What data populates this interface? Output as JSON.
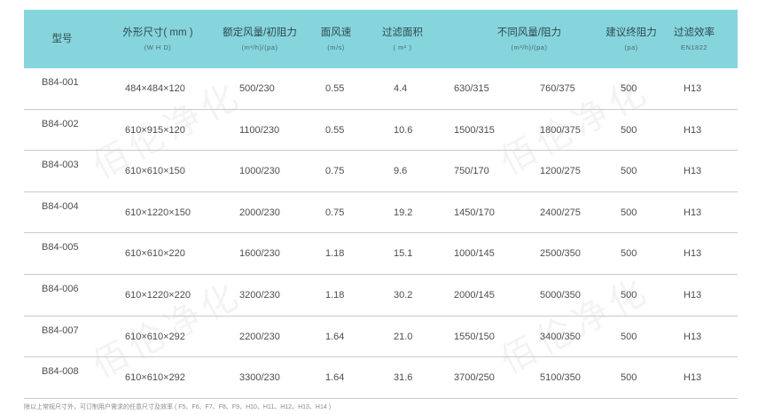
{
  "headers": {
    "model": {
      "main": "型号",
      "sub": ""
    },
    "size": {
      "main": "外形尺寸( mm )",
      "sub": "(W H D)"
    },
    "rated": {
      "main": "额定风量/初阻力",
      "sub": "(m³/h)/(pa)"
    },
    "velocity": {
      "main": "面风速",
      "sub": "(m/s)"
    },
    "area": {
      "main": "过滤面积",
      "sub": "( m² )"
    },
    "diff": {
      "main": "不同风量/阻力",
      "sub": "(m³/h)/(pa)"
    },
    "final": {
      "main": "建议终阻力",
      "sub": "(pa)"
    },
    "eff": {
      "main": "过滤效率",
      "sub": "EN1822"
    }
  },
  "rows": [
    {
      "model": "B84-001",
      "size": "484×484×120",
      "rated": "500/230",
      "velocity": "0.55",
      "area": "4.4",
      "diff1": "630/315",
      "diff2": "760/375",
      "final": "500",
      "eff": "H13"
    },
    {
      "model": "B84-002",
      "size": "610×915×120",
      "rated": "1100/230",
      "velocity": "0.55",
      "area": "10.6",
      "diff1": "1500/315",
      "diff2": "1800/375",
      "final": "500",
      "eff": "H13"
    },
    {
      "model": "B84-003",
      "size": "610×610×150",
      "rated": "1000/230",
      "velocity": "0.75",
      "area": "9.6",
      "diff1": "750/170",
      "diff2": "1200/275",
      "final": "500",
      "eff": "H13"
    },
    {
      "model": "B84-004",
      "size": "610×1220×150",
      "rated": "2000/230",
      "velocity": "0.75",
      "area": "19.2",
      "diff1": "1450/170",
      "diff2": "2400/275",
      "final": "500",
      "eff": "H13"
    },
    {
      "model": "B84-005",
      "size": "610×610×220",
      "rated": "1600/230",
      "velocity": "1.18",
      "area": "15.1",
      "diff1": "1000/145",
      "diff2": "2500/350",
      "final": "500",
      "eff": "H13"
    },
    {
      "model": "B84-006",
      "size": "610×1220×220",
      "rated": "3200/230",
      "velocity": "1.18",
      "area": "30.2",
      "diff1": "2000/145",
      "diff2": "5000/350",
      "final": "500",
      "eff": "H13"
    },
    {
      "model": "B84-007",
      "size": "610×610×292",
      "rated": "2200/230",
      "velocity": "1.64",
      "area": "21.0",
      "diff1": "1550/150",
      "diff2": "3400/350",
      "final": "500",
      "eff": "H13"
    },
    {
      "model": "B84-008",
      "size": "610×610×292",
      "rated": "3300/230",
      "velocity": "1.64",
      "area": "31.6",
      "diff1": "3700/250",
      "diff2": "5100/350",
      "final": "500",
      "eff": "H13"
    }
  ],
  "note": "除以上常规尺寸外，可订制用户需求的任意尺寸及效率 ( F5、F6、F7、F8、F9、H10、H11、H12、H13、H14 )",
  "watermark": "佰伦净化",
  "colors": {
    "header_bg": "#86d5dd",
    "row_border": "#c9c9c9"
  }
}
